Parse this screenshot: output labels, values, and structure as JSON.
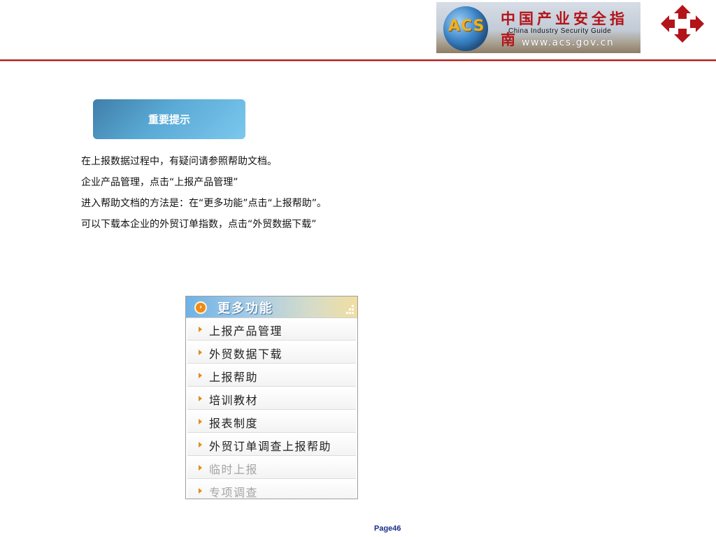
{
  "header": {
    "banner": {
      "logo_text": "ACS",
      "title_cn": "中国产业安全指南",
      "title_en": "China  Industry  Security  Guide",
      "url": "www.acs.gov.cn"
    },
    "brand_logo_icon": "red-diamond-arrows-logo-icon",
    "accent_color": "#b01a1a"
  },
  "notice": {
    "label": "重要提示"
  },
  "instructions": [
    "在上报数据过程中，有疑问请参照帮助文档。",
    "企业产品管理，点击“上报产品管理”",
    "进入帮助文档的方法是：在“更多功能”点击“上报帮助”。",
    "可以下载本企业的外贸订单指数，点击“外贸数据下载”"
  ],
  "menu": {
    "title": "更多功能",
    "icon": "circle-arrow-icon",
    "items": [
      {
        "label": "上报产品管理",
        "enabled": true
      },
      {
        "label": "外贸数据下载",
        "enabled": true
      },
      {
        "label": "上报帮助",
        "enabled": true
      },
      {
        "label": "培训教材",
        "enabled": true
      },
      {
        "label": "报表制度",
        "enabled": true
      },
      {
        "label": "外贸订单调查上报帮助",
        "enabled": true
      },
      {
        "label": "临时上报",
        "enabled": false
      },
      {
        "label": "专项调查",
        "enabled": false
      }
    ]
  },
  "footer": {
    "page": "Page46"
  }
}
